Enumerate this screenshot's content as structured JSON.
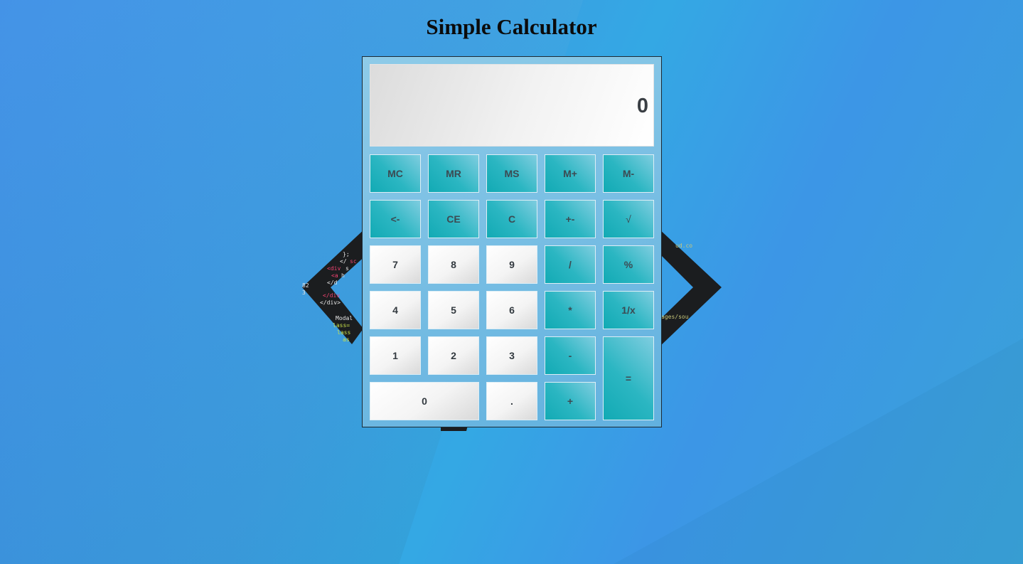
{
  "page": {
    "title": "Simple Calculator"
  },
  "display": {
    "value": "0"
  },
  "keys": {
    "mc": "MC",
    "mr": "MR",
    "ms": "MS",
    "m_plus": "M+",
    "m_minus": "M-",
    "backspace": "<-",
    "ce": "CE",
    "c": "C",
    "plus_minus": "+-",
    "sqrt": "√",
    "seven": "7",
    "eight": "8",
    "nine": "9",
    "divide": "/",
    "percent": "%",
    "four": "4",
    "five": "5",
    "six": "6",
    "multiply": "*",
    "reciprocal": "1/x",
    "one": "1",
    "two": "2",
    "three": "3",
    "minus": "-",
    "equals": "=",
    "zero": "0",
    "decimal": ".",
    "plus": "+"
  },
  "colors": {
    "operator_key": "#2bb6c2",
    "digit_key": "#f4f4f4",
    "calculator_body": "#6fb8e2"
  }
}
